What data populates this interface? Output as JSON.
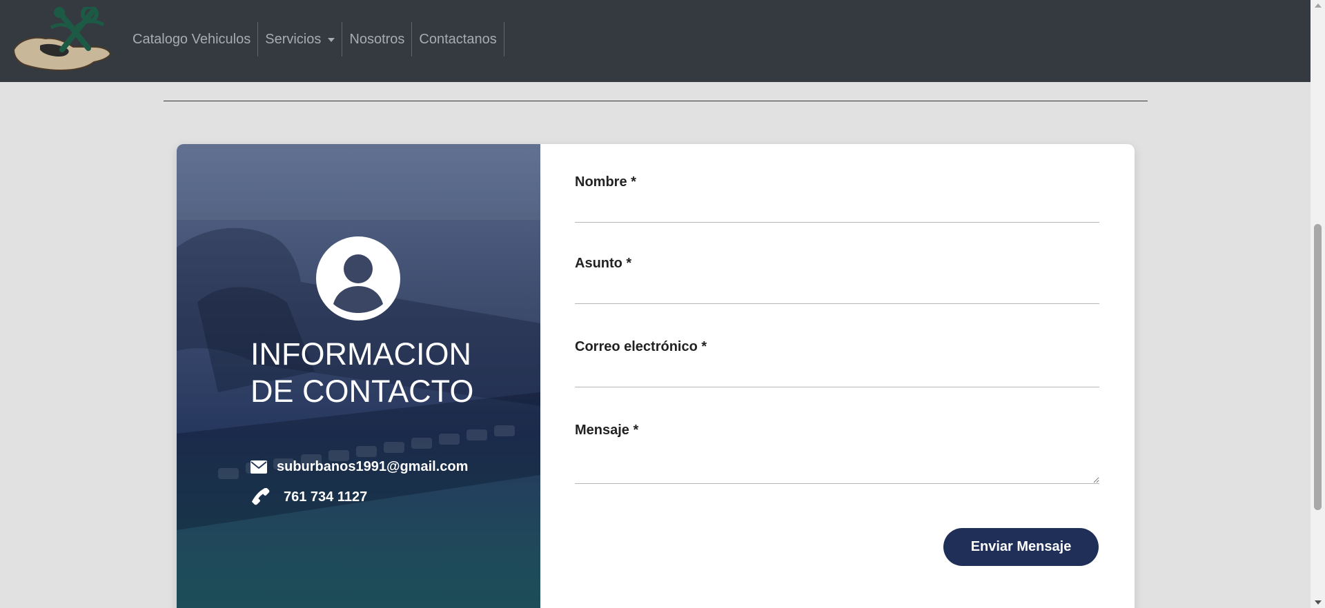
{
  "navbar": {
    "logo": "hand-with-tools-logo",
    "links": [
      {
        "label": "Catalogo Vehiculos"
      },
      {
        "label": "Servicios",
        "has_dropdown": true
      },
      {
        "label": "Nosotros"
      },
      {
        "label": "Contactanos"
      }
    ]
  },
  "contact_info": {
    "title_line1": "INFORMACION",
    "title_line2": "DE CONTACTO",
    "avatar_icon": "user-circle-icon",
    "email_icon": "envelope-icon",
    "email": "suburbanos1991@gmail.com",
    "phone_icon": "phone-icon",
    "phone": "761 734 1127"
  },
  "form": {
    "fields": [
      {
        "label": "Nombre *",
        "value": ""
      },
      {
        "label": "Asunto *",
        "value": ""
      },
      {
        "label": "Correo electrónico *",
        "value": ""
      },
      {
        "label": "Mensaje *",
        "value": ""
      }
    ],
    "submit_label": "Enviar Mensaje"
  },
  "colors": {
    "navbar_bg": "#343a40",
    "page_bg": "#e1e1e1",
    "button_bg": "#1f2f57",
    "panel_gradient_top": "#5a6a8c",
    "panel_gradient_bottom": "#1c4e58"
  }
}
